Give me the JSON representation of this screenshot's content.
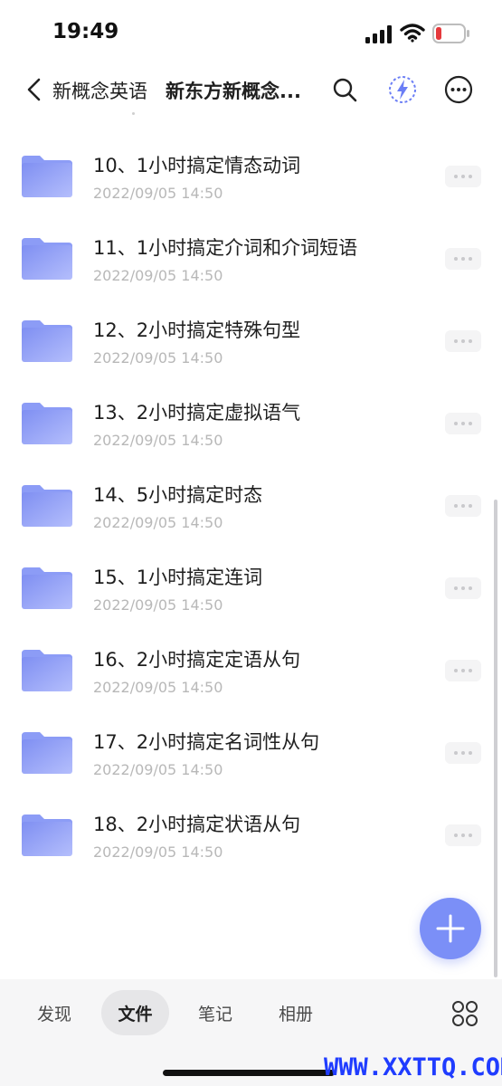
{
  "status_bar": {
    "time": "19:49",
    "icons": [
      "signal-icon",
      "wifi-icon",
      "battery-icon"
    ],
    "battery_color": "#e5393c"
  },
  "header": {
    "parent_folder": "新概念英语",
    "current_folder": "新东方新概念英语语法精讲",
    "current_folder_display": "新东方新概念...",
    "icons": [
      "back-icon",
      "search-icon",
      "flash-icon",
      "more-icon"
    ]
  },
  "files": [
    {
      "name": "10、1小时搞定情态动词",
      "date": "2022/09/05 14:50"
    },
    {
      "name": "11、1小时搞定介词和介词短语",
      "date": "2022/09/05 14:50"
    },
    {
      "name": "12、2小时搞定特殊句型",
      "date": "2022/09/05 14:50"
    },
    {
      "name": "13、2小时搞定虚拟语气",
      "date": "2022/09/05 14:50"
    },
    {
      "name": "14、5小时搞定时态",
      "date": "2022/09/05 14:50"
    },
    {
      "name": "15、1小时搞定连词",
      "date": "2022/09/05 14:50"
    },
    {
      "name": "16、2小时搞定定语从句",
      "date": "2022/09/05 14:50"
    },
    {
      "name": "17、2小时搞定名词性从句",
      "date": "2022/09/05 14:50"
    },
    {
      "name": "18、2小时搞定状语从句",
      "date": "2022/09/05 14:50"
    }
  ],
  "fab": {
    "icon": "plus-icon",
    "color": "#7b8ff7"
  },
  "bottom_nav": {
    "tabs": [
      {
        "label": "发现",
        "active": false
      },
      {
        "label": "文件",
        "active": true
      },
      {
        "label": "笔记",
        "active": false
      },
      {
        "label": "相册",
        "active": false
      }
    ],
    "apps_icon": "apps-grid-icon"
  },
  "watermark": "WWW.XXTTQ.COM",
  "colors": {
    "accent": "#7b8ff7",
    "folder_top": "#7f8ff2",
    "folder_bottom": "#aab6fb",
    "date_text": "#b8b8b8"
  }
}
